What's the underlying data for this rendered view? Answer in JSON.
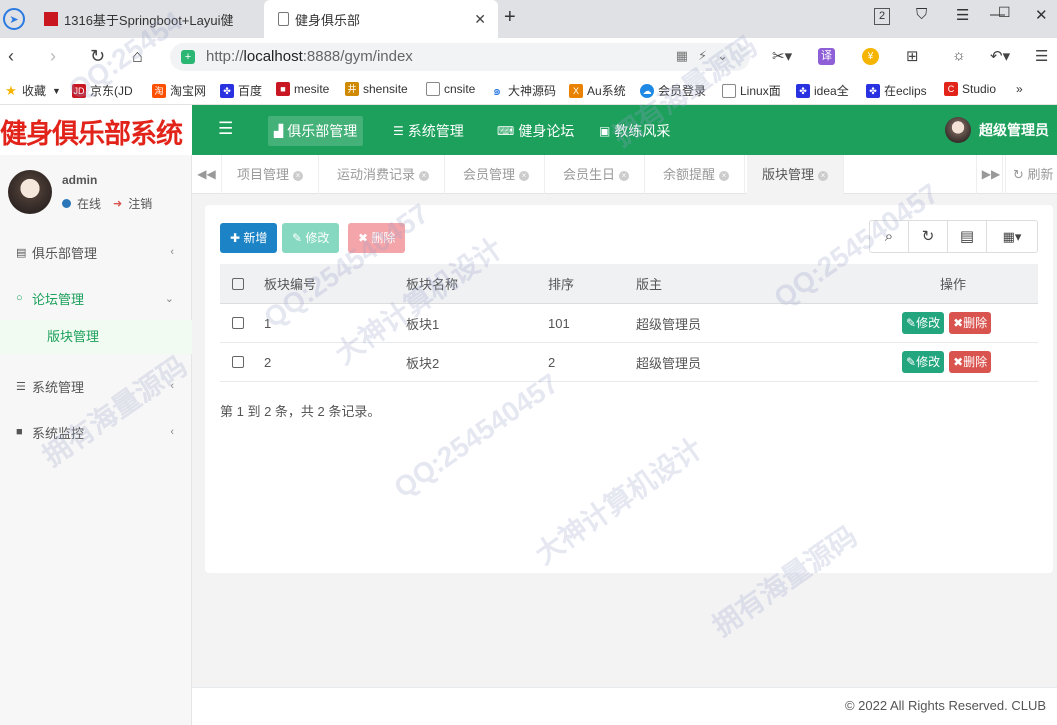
{
  "browser": {
    "tabs": [
      {
        "title": "1316基于Springboot+Layui健"
      },
      {
        "title": "健身俱乐部"
      }
    ],
    "badge": "2",
    "url_prefix": "http://",
    "url_host": "localhost",
    "url_rest": ":8888/gym/index",
    "bookmarks": [
      "收藏",
      "京东(JD",
      "淘宝网",
      "百度",
      "mesite",
      "shensite",
      "cnsite",
      "大神源码",
      "Au系统",
      "会员登录",
      "Linux面",
      "idea全",
      "在eclips",
      "Studio"
    ]
  },
  "header": {
    "logo": "健身俱乐部系统",
    "nav": [
      "俱乐部管理",
      "系统管理",
      "健身论坛",
      "教练风采"
    ],
    "user": "超级管理员"
  },
  "sidebar": {
    "username": "admin",
    "status": "在线",
    "logout": "注销",
    "menus": [
      {
        "label": "俱乐部管理"
      },
      {
        "label": "论坛管理"
      },
      {
        "label": "系统管理"
      },
      {
        "label": "系统监控"
      }
    ],
    "submenu": "版块管理"
  },
  "content_tabs": [
    "项目管理",
    "运动消费记录",
    "会员管理",
    "会员生日",
    "余额提醒",
    "版块管理"
  ],
  "refresh": "刷新",
  "toolbar": {
    "add": "新增",
    "edit": "修改",
    "delete": "删除"
  },
  "table": {
    "headers": [
      "板块编号",
      "板块名称",
      "排序",
      "版主",
      "操作"
    ],
    "rows": [
      {
        "id": "1",
        "name": "板块1",
        "sort": "101",
        "owner": "超级管理员"
      },
      {
        "id": "2",
        "name": "板块2",
        "sort": "2",
        "owner": "超级管理员"
      }
    ],
    "row_edit": "修改",
    "row_delete": "删除"
  },
  "pager": "第 1 到 2 条，共 2 条记录。",
  "footer": "© 2022 All Rights Reserved. CLUB",
  "watermarks": [
    "QQ:25454",
    "QQ:254540457",
    "拥有海量源码",
    "大神计算机设计",
    "QQ:254540457",
    "拥有海量源码",
    "大神计算机设计",
    "QQ:254540457",
    "拥有海量源码"
  ],
  "colors": {
    "header": "#1ca05c",
    "primary": "#1c84c6",
    "danger": "#d9534f",
    "logo": "#e2231a"
  }
}
